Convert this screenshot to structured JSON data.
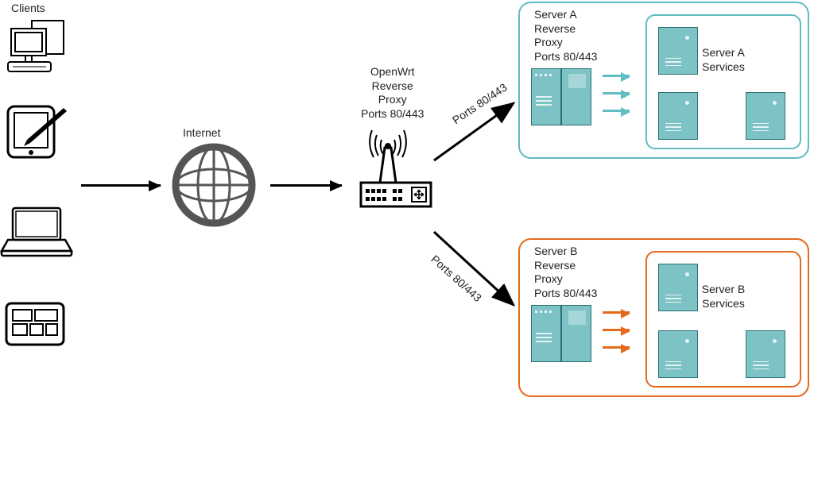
{
  "labels": {
    "clients": "Clients",
    "internet": "Internet",
    "router": "OpenWrt\nReverse\nProxy\nPorts 80/443",
    "ports_upper": "Ports 80/443",
    "ports_lower": "Ports 80/443",
    "server_a_proxy": "Server A\nReverse\nProxy\nPorts 80/443",
    "server_a_services": "Server A\nServices",
    "server_b_proxy": "Server B\nReverse\nProxy\nPorts 80/443",
    "server_b_services": "Server B\nServices"
  },
  "colors": {
    "teal_border": "#5fbcc0",
    "orange_border": "#e46a1e",
    "server_fill": "#7dc3c6",
    "server_stroke": "#2a6f72"
  },
  "diagram": {
    "description": "Client devices connect through the Internet to an OpenWrt reverse proxy router on ports 80/443, which forwards traffic to two backend servers (A and B). Each server runs its own reverse proxy on ports 80/443 in front of its services.",
    "nodes": [
      {
        "id": "clients",
        "kind": "client-devices"
      },
      {
        "id": "internet",
        "kind": "internet-cloud"
      },
      {
        "id": "router",
        "kind": "openwrt-router",
        "ports": "80/443"
      },
      {
        "id": "server_a_proxy",
        "kind": "reverse-proxy",
        "host": "Server A",
        "ports": "80/443"
      },
      {
        "id": "server_a_services",
        "kind": "services",
        "host": "Server A"
      },
      {
        "id": "server_b_proxy",
        "kind": "reverse-proxy",
        "host": "Server B",
        "ports": "80/443"
      },
      {
        "id": "server_b_services",
        "kind": "services",
        "host": "Server B"
      }
    ],
    "edges": [
      {
        "from": "clients",
        "to": "internet"
      },
      {
        "from": "internet",
        "to": "router"
      },
      {
        "from": "router",
        "to": "server_a_proxy",
        "label": "Ports 80/443"
      },
      {
        "from": "router",
        "to": "server_b_proxy",
        "label": "Ports 80/443"
      },
      {
        "from": "server_a_proxy",
        "to": "server_a_services"
      },
      {
        "from": "server_b_proxy",
        "to": "server_b_services"
      }
    ]
  }
}
